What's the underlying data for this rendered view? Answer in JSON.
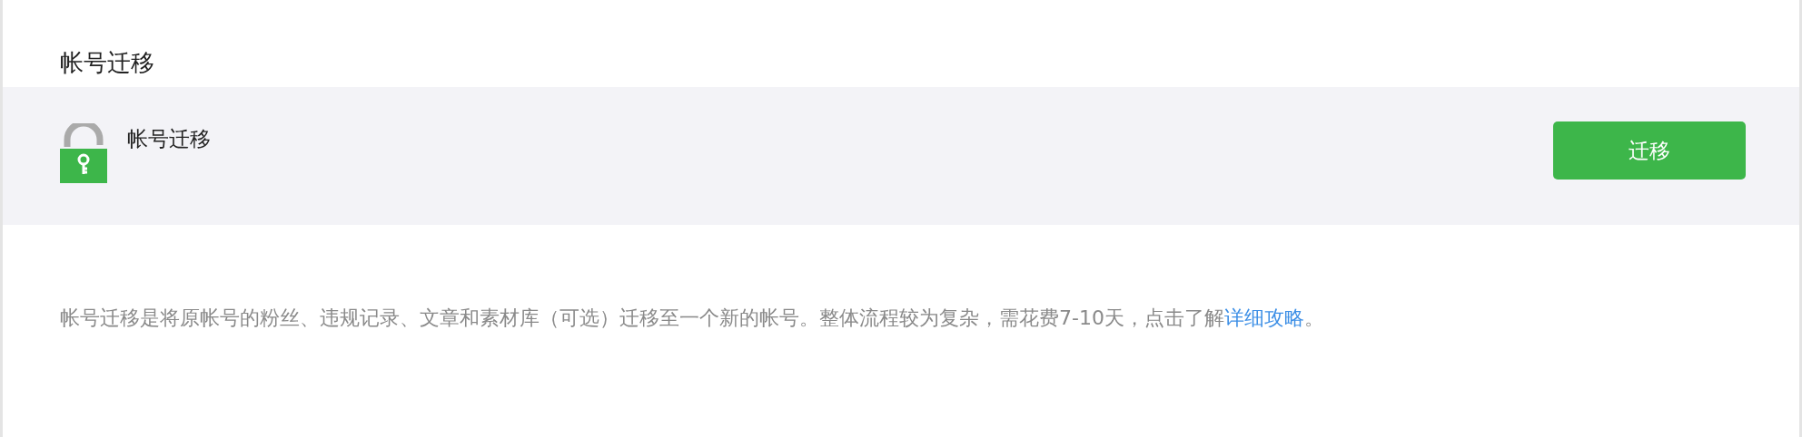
{
  "page_title": "帐号迁移",
  "item": {
    "title": "帐号迁移",
    "button": "迁移"
  },
  "description": {
    "text": "帐号迁移是将原帐号的粉丝、违规记录、文章和素材库（可选）迁移至一个新的帐号。整体流程较为复杂，需花费7-10天，点击了解",
    "link": "详细攻略",
    "end": "。"
  }
}
